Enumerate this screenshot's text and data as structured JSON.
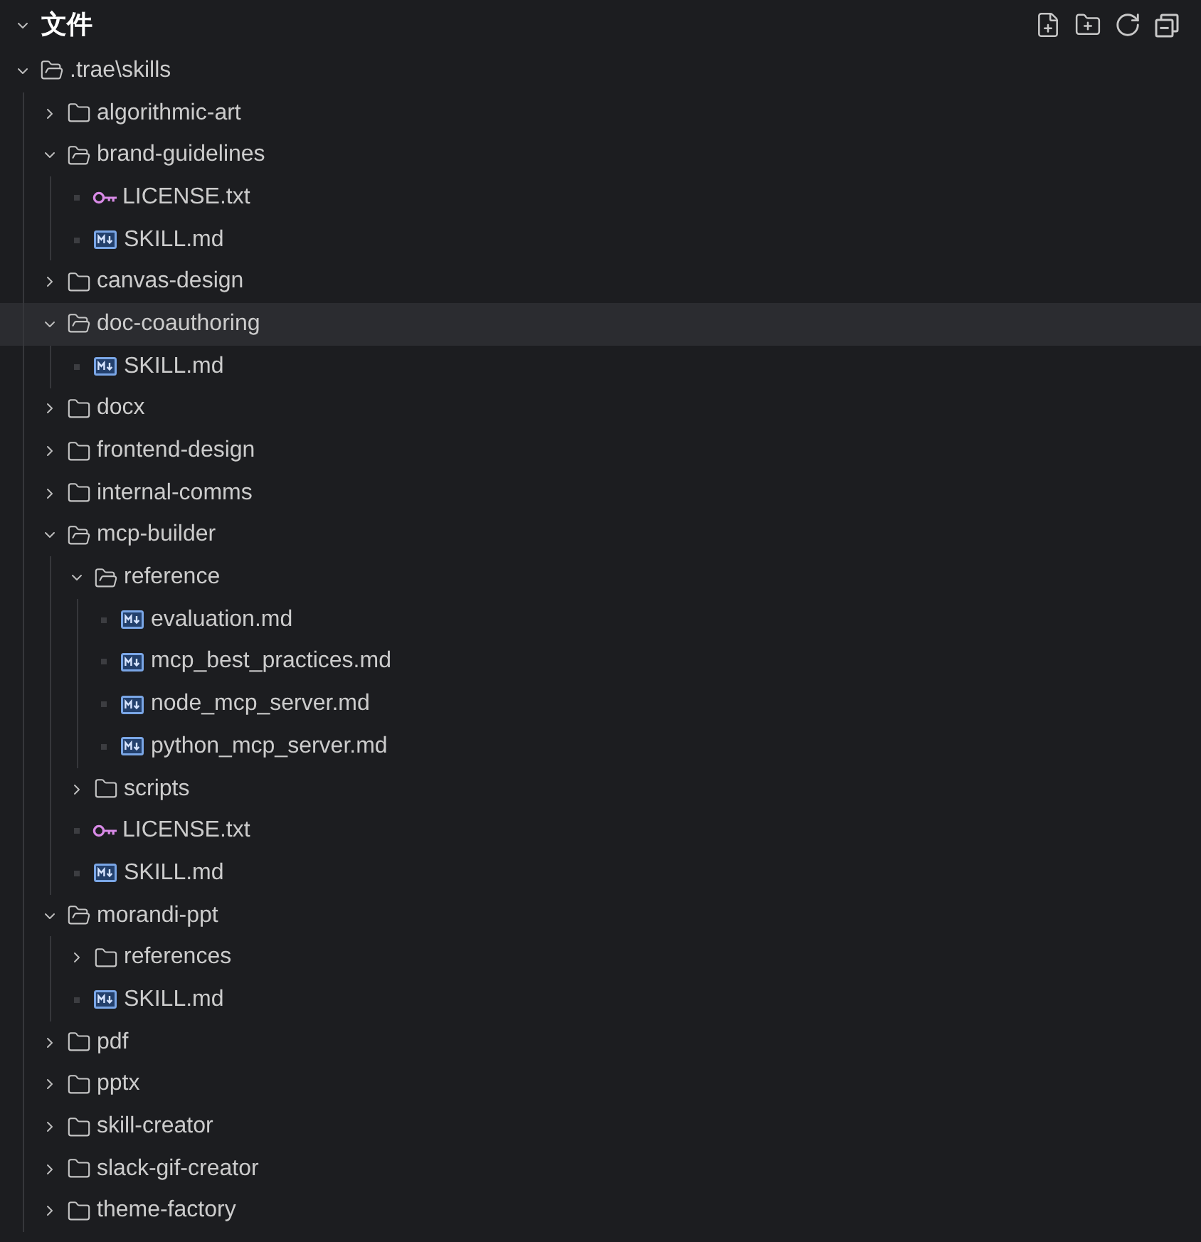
{
  "panel": {
    "title": "文件",
    "expanded": true
  },
  "tree": [
    {
      "kind": "folder",
      "name": ".trae\\skills",
      "expanded": true,
      "selected": false,
      "children": [
        {
          "kind": "folder",
          "name": "algorithmic-art",
          "expanded": false,
          "selected": false
        },
        {
          "kind": "folder",
          "name": "brand-guidelines",
          "expanded": true,
          "selected": false,
          "children": [
            {
              "kind": "license",
              "name": "LICENSE.txt",
              "selected": false
            },
            {
              "kind": "markdown",
              "name": "SKILL.md",
              "selected": false
            }
          ]
        },
        {
          "kind": "folder",
          "name": "canvas-design",
          "expanded": false,
          "selected": false
        },
        {
          "kind": "folder",
          "name": "doc-coauthoring",
          "expanded": true,
          "selected": true,
          "children": [
            {
              "kind": "markdown",
              "name": "SKILL.md",
              "selected": false
            }
          ]
        },
        {
          "kind": "folder",
          "name": "docx",
          "expanded": false,
          "selected": false
        },
        {
          "kind": "folder",
          "name": "frontend-design",
          "expanded": false,
          "selected": false
        },
        {
          "kind": "folder",
          "name": "internal-comms",
          "expanded": false,
          "selected": false
        },
        {
          "kind": "folder",
          "name": "mcp-builder",
          "expanded": true,
          "selected": false,
          "children": [
            {
              "kind": "folder",
              "name": "reference",
              "expanded": true,
              "selected": false,
              "children": [
                {
                  "kind": "markdown",
                  "name": "evaluation.md",
                  "selected": false
                },
                {
                  "kind": "markdown",
                  "name": "mcp_best_practices.md",
                  "selected": false
                },
                {
                  "kind": "markdown",
                  "name": "node_mcp_server.md",
                  "selected": false
                },
                {
                  "kind": "markdown",
                  "name": "python_mcp_server.md",
                  "selected": false
                }
              ]
            },
            {
              "kind": "folder",
              "name": "scripts",
              "expanded": false,
              "selected": false
            },
            {
              "kind": "license",
              "name": "LICENSE.txt",
              "selected": false
            },
            {
              "kind": "markdown",
              "name": "SKILL.md",
              "selected": false
            }
          ]
        },
        {
          "kind": "folder",
          "name": "morandi-ppt",
          "expanded": true,
          "selected": false,
          "children": [
            {
              "kind": "folder",
              "name": "references",
              "expanded": false,
              "selected": false
            },
            {
              "kind": "markdown",
              "name": "SKILL.md",
              "selected": false
            }
          ]
        },
        {
          "kind": "folder",
          "name": "pdf",
          "expanded": false,
          "selected": false
        },
        {
          "kind": "folder",
          "name": "pptx",
          "expanded": false,
          "selected": false
        },
        {
          "kind": "folder",
          "name": "skill-creator",
          "expanded": false,
          "selected": false
        },
        {
          "kind": "folder",
          "name": "slack-gif-creator",
          "expanded": false,
          "selected": false
        },
        {
          "kind": "folder",
          "name": "theme-factory",
          "expanded": false,
          "selected": false
        }
      ]
    }
  ]
}
